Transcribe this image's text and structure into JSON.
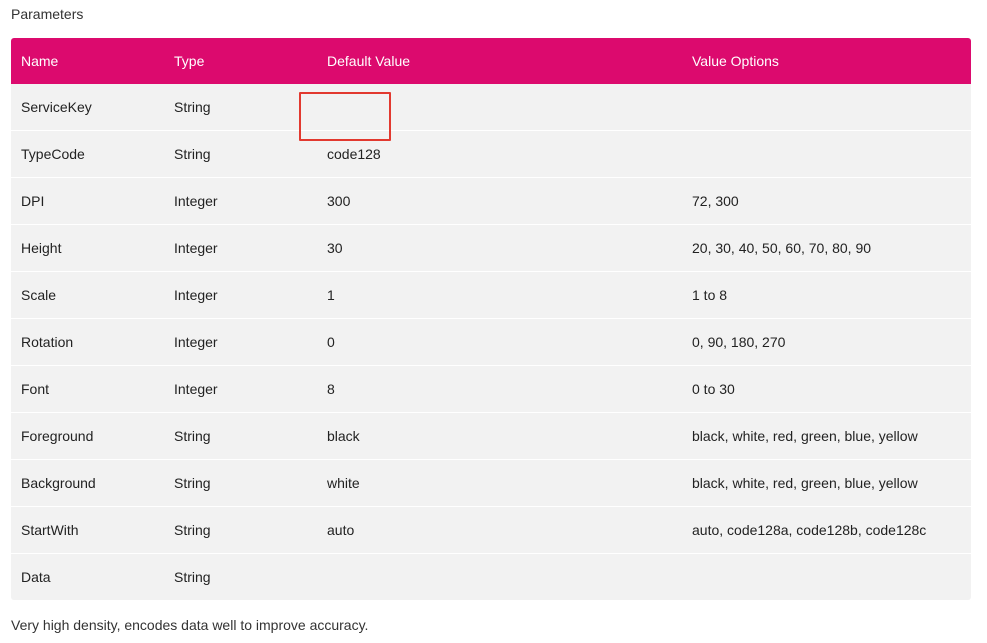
{
  "caption": "Parameters",
  "columns": [
    "Name",
    "Type",
    "Default Value",
    "Value Options"
  ],
  "rows": [
    {
      "name": "ServiceKey",
      "type": "String",
      "default": "",
      "options": ""
    },
    {
      "name": "TypeCode",
      "type": "String",
      "default": "code128",
      "options": ""
    },
    {
      "name": "DPI",
      "type": "Integer",
      "default": "300",
      "options": "72, 300"
    },
    {
      "name": "Height",
      "type": "Integer",
      "default": "30",
      "options": "20, 30, 40, 50, 60, 70, 80, 90"
    },
    {
      "name": "Scale",
      "type": "Integer",
      "default": "1",
      "options": "1 to 8"
    },
    {
      "name": "Rotation",
      "type": "Integer",
      "default": "0",
      "options": "0, 90, 180, 270"
    },
    {
      "name": "Font",
      "type": "Integer",
      "default": "8",
      "options": "0 to 30"
    },
    {
      "name": "Foreground",
      "type": "String",
      "default": "black",
      "options": "black, white, red, green, blue, yellow"
    },
    {
      "name": "Background",
      "type": "String",
      "default": "white",
      "options": "black, white, red, green, blue, yellow"
    },
    {
      "name": "StartWith",
      "type": "String",
      "default": "auto",
      "options": "auto, code128a, code128b, code128c"
    },
    {
      "name": "Data",
      "type": "String",
      "default": "",
      "options": ""
    }
  ],
  "footer": "Very high density, encodes data well to improve accuracy.",
  "colors": {
    "header_bg": "#dc0a6e",
    "row_bg": "#f2f2f2",
    "highlight_border": "#e2392f"
  }
}
